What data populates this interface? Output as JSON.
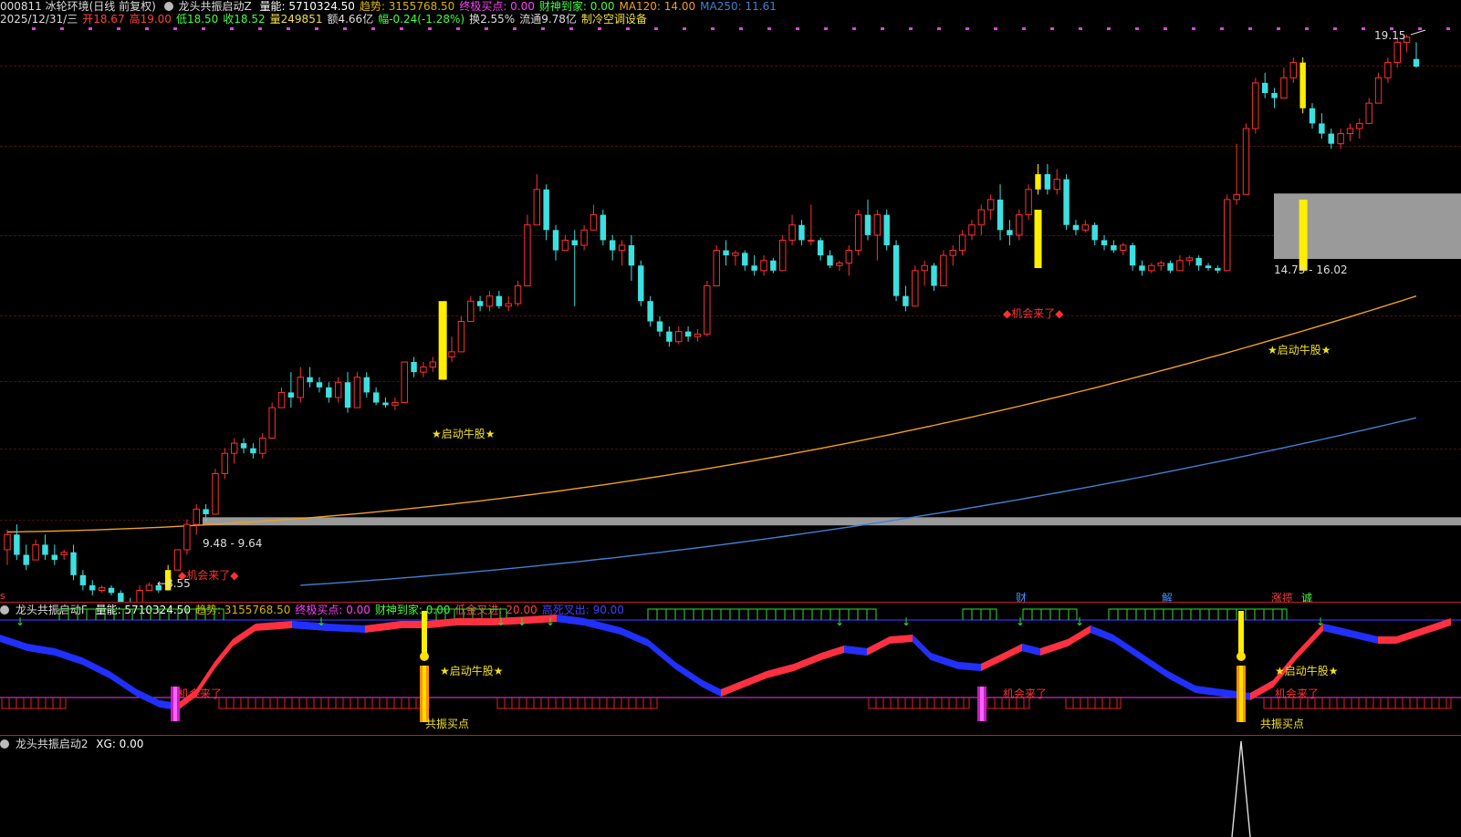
{
  "header": {
    "code_name": "000811 冰轮环境(日线 前复权)",
    "indicator_name": "龙头共振启动Z",
    "fields": [
      {
        "text": "量能: 5710324.50",
        "color": "#ffffff"
      },
      {
        "text": "趋势: 3155768.50",
        "color": "#d8b400"
      },
      {
        "text": "终极买点: 0.00",
        "color": "#ff40ff"
      },
      {
        "text": "财神到家: 0.00",
        "color": "#40ff40"
      },
      {
        "text": "MA120: 14.00",
        "color": "#f0a020"
      },
      {
        "text": "MA250: 11.61",
        "color": "#4080d0"
      }
    ],
    "quote": [
      {
        "text": "2025/12/31/三",
        "color": "#dddddd"
      },
      {
        "text": "开18.67",
        "color": "#ff4040"
      },
      {
        "text": "高19.00",
        "color": "#ff4040"
      },
      {
        "text": "低18.50",
        "color": "#40ff40"
      },
      {
        "text": "收18.52",
        "color": "#40ff40"
      },
      {
        "text": "量249851",
        "color": "#f0e040"
      },
      {
        "text": "额4.66亿",
        "color": "#dddddd"
      },
      {
        "text": "幅-0.24(-1.28%)",
        "color": "#40ff40"
      },
      {
        "text": "换2.55%",
        "color": "#dddddd"
      },
      {
        "text": "流通9.78亿",
        "color": "#dddddd"
      },
      {
        "text": "制冷空调设备",
        "color": "#f0e040"
      }
    ]
  },
  "main_chart": {
    "labels": {
      "high_price": "19.15",
      "low_price": "8.55",
      "zone_low": "9.48 - 9.64",
      "zone_high": "14.73 - 16.02",
      "signal_start": "★启动牛股★",
      "signal_chance": "◆机会来了◆"
    },
    "bottom_tags": [
      {
        "text": "财",
        "color": "#4090ff"
      },
      {
        "text": "解",
        "color": "#4090ff"
      },
      {
        "text": "涨揽",
        "color": "#ff4040"
      },
      {
        "text": "诚",
        "color": "#40ff40"
      }
    ]
  },
  "sub_chart_1": {
    "name": "龙头共振启动F",
    "fields": [
      {
        "text": "量能: 5710324.50",
        "color": "#ffffff"
      },
      {
        "text": "趋势: 3155768.50",
        "color": "#d8b400"
      },
      {
        "text": "终极买点: 0.00",
        "color": "#ff40ff"
      },
      {
        "text": "财神到家: 0.00",
        "color": "#40ff40"
      },
      {
        "text": "低金叉进: 20.00",
        "color": "#ff4040"
      },
      {
        "text": "高死叉出: 90.00",
        "color": "#4040ff"
      }
    ],
    "labels": {
      "start": "★启动牛股★",
      "chance": "机会来了",
      "buy": "共振买点"
    }
  },
  "sub_chart_2": {
    "name": "龙头共振启动2",
    "fields": [
      {
        "text": "XG: 0.00",
        "color": "#ffffff"
      }
    ]
  },
  "chart_data": {
    "type": "candlestick",
    "ma_series": [
      {
        "name": "MA120",
        "color": "#f0a020",
        "last_value": 14.0
      },
      {
        "name": "MA250",
        "color": "#4080d0",
        "last_value": 11.61
      }
    ],
    "candles": [
      [
        9.0,
        9.4,
        8.7,
        9.3
      ],
      [
        9.3,
        9.5,
        8.8,
        8.9
      ],
      [
        8.9,
        9.1,
        8.6,
        8.7
      ],
      [
        8.8,
        9.2,
        8.8,
        9.1
      ],
      [
        9.1,
        9.3,
        8.8,
        8.9
      ],
      [
        8.9,
        9.1,
        8.7,
        8.8
      ],
      [
        8.9,
        9.0,
        8.8,
        8.95
      ],
      [
        8.95,
        9.1,
        8.4,
        8.5
      ],
      [
        8.5,
        8.6,
        8.2,
        8.3
      ],
      [
        8.3,
        8.4,
        8.1,
        8.2
      ],
      [
        8.2,
        8.3,
        8.15,
        8.25
      ],
      [
        8.25,
        8.3,
        8.1,
        8.15
      ],
      [
        8.15,
        8.2,
        7.9,
        7.95
      ],
      [
        7.95,
        8.05,
        7.85,
        7.9
      ],
      [
        7.9,
        8.3,
        7.9,
        8.2
      ],
      [
        8.2,
        8.35,
        8.2,
        8.3
      ],
      [
        8.3,
        8.35,
        8.15,
        8.2
      ],
      [
        8.2,
        8.7,
        8.2,
        8.6
      ],
      [
        8.6,
        9.0,
        8.6,
        9.0
      ],
      [
        9.0,
        9.6,
        8.9,
        9.5
      ],
      [
        9.5,
        9.9,
        9.3,
        9.8
      ],
      [
        9.8,
        9.9,
        9.55,
        9.7
      ],
      [
        9.7,
        10.6,
        9.7,
        10.5
      ],
      [
        10.5,
        11.0,
        10.4,
        10.9
      ],
      [
        10.9,
        11.2,
        10.7,
        11.1
      ],
      [
        11.1,
        11.2,
        10.9,
        11.0
      ],
      [
        11.0,
        11.1,
        10.8,
        10.9
      ],
      [
        10.9,
        11.3,
        10.8,
        11.2
      ],
      [
        11.2,
        11.9,
        11.2,
        11.8
      ],
      [
        11.8,
        12.2,
        11.8,
        12.1
      ],
      [
        12.1,
        12.5,
        11.8,
        12.0
      ],
      [
        12.0,
        12.6,
        11.9,
        12.4
      ],
      [
        12.4,
        12.6,
        12.2,
        12.3
      ],
      [
        12.3,
        12.4,
        12.1,
        12.2
      ],
      [
        12.2,
        12.3,
        11.9,
        12.0
      ],
      [
        12.0,
        12.4,
        11.9,
        12.3
      ],
      [
        12.3,
        12.5,
        11.7,
        11.8
      ],
      [
        11.8,
        12.5,
        11.8,
        12.4
      ],
      [
        12.4,
        12.5,
        12.0,
        12.1
      ],
      [
        12.1,
        12.2,
        11.85,
        11.9
      ],
      [
        11.9,
        12.0,
        11.8,
        11.85
      ],
      [
        11.85,
        12.0,
        11.75,
        11.9
      ],
      [
        11.9,
        12.6,
        11.9,
        12.7
      ],
      [
        12.7,
        12.8,
        12.4,
        12.5
      ],
      [
        12.5,
        12.7,
        12.4,
        12.6
      ],
      [
        12.6,
        12.8,
        12.5,
        12.7
      ],
      [
        12.7,
        12.9,
        12.6,
        12.8
      ],
      [
        12.8,
        13.2,
        12.7,
        12.9
      ],
      [
        12.9,
        13.6,
        12.9,
        13.5
      ],
      [
        13.5,
        14.0,
        13.5,
        13.9
      ],
      [
        13.9,
        14.0,
        13.7,
        13.8
      ],
      [
        13.8,
        14.1,
        13.7,
        14.0
      ],
      [
        14.0,
        14.1,
        13.75,
        13.8
      ],
      [
        13.8,
        14.0,
        13.7,
        13.85
      ],
      [
        13.85,
        14.3,
        13.8,
        14.2
      ],
      [
        14.2,
        15.6,
        14.2,
        15.4
      ],
      [
        15.4,
        16.4,
        15.4,
        16.1
      ],
      [
        16.1,
        16.2,
        15.1,
        15.3
      ],
      [
        15.3,
        15.4,
        14.7,
        14.9
      ],
      [
        14.9,
        15.2,
        14.9,
        15.1
      ],
      [
        15.1,
        15.3,
        13.8,
        15.0
      ],
      [
        15.0,
        15.4,
        14.9,
        15.3
      ],
      [
        15.3,
        15.8,
        15.3,
        15.6
      ],
      [
        15.6,
        15.7,
        15.0,
        15.1
      ],
      [
        15.1,
        15.2,
        14.7,
        14.9
      ],
      [
        14.9,
        15.1,
        14.6,
        15.0
      ],
      [
        15.0,
        15.2,
        14.3,
        14.6
      ],
      [
        14.6,
        14.7,
        13.8,
        13.9
      ],
      [
        13.9,
        14.0,
        13.4,
        13.5
      ],
      [
        13.5,
        13.6,
        13.2,
        13.3
      ],
      [
        13.3,
        13.4,
        13.0,
        13.1
      ],
      [
        13.1,
        13.4,
        13.05,
        13.3
      ],
      [
        13.3,
        13.4,
        13.1,
        13.2
      ],
      [
        13.2,
        13.35,
        13.1,
        13.25
      ],
      [
        13.25,
        14.3,
        13.2,
        14.2
      ],
      [
        14.2,
        15.0,
        14.2,
        14.9
      ],
      [
        14.9,
        15.1,
        14.6,
        14.8
      ],
      [
        14.8,
        14.9,
        14.6,
        14.85
      ],
      [
        14.85,
        14.9,
        14.5,
        14.6
      ],
      [
        14.6,
        14.8,
        14.4,
        14.5
      ],
      [
        14.5,
        14.8,
        14.4,
        14.7
      ],
      [
        14.7,
        14.75,
        14.45,
        14.5
      ],
      [
        14.5,
        15.2,
        14.5,
        15.1
      ],
      [
        15.1,
        15.6,
        15.0,
        15.4
      ],
      [
        15.4,
        15.5,
        15.0,
        15.1
      ],
      [
        15.1,
        15.8,
        15.0,
        15.1
      ],
      [
        15.1,
        15.15,
        14.7,
        14.8
      ],
      [
        14.8,
        14.9,
        14.55,
        14.6
      ],
      [
        14.6,
        14.7,
        14.5,
        14.65
      ],
      [
        14.65,
        15.0,
        14.4,
        14.9
      ],
      [
        14.9,
        15.7,
        14.8,
        15.6
      ],
      [
        15.6,
        15.9,
        15.1,
        15.2
      ],
      [
        15.2,
        15.7,
        14.7,
        15.6
      ],
      [
        15.6,
        15.7,
        14.9,
        15.0
      ],
      [
        15.0,
        15.1,
        13.9,
        14.0
      ],
      [
        14.0,
        14.2,
        13.7,
        13.8
      ],
      [
        13.8,
        14.6,
        13.8,
        14.5
      ],
      [
        14.5,
        14.7,
        14.2,
        14.6
      ],
      [
        14.6,
        14.65,
        14.1,
        14.2
      ],
      [
        14.2,
        14.9,
        14.2,
        14.8
      ],
      [
        14.8,
        15.0,
        14.6,
        14.9
      ],
      [
        14.9,
        15.3,
        14.8,
        15.2
      ],
      [
        15.2,
        15.5,
        15.1,
        15.4
      ],
      [
        15.4,
        15.8,
        15.2,
        15.7
      ],
      [
        15.7,
        16.0,
        15.5,
        15.9
      ],
      [
        15.9,
        16.2,
        15.1,
        15.3
      ],
      [
        15.3,
        15.5,
        15.0,
        15.2
      ],
      [
        15.2,
        15.7,
        15.1,
        15.6
      ],
      [
        15.6,
        16.2,
        15.5,
        16.1
      ],
      [
        16.1,
        16.6,
        16.0,
        16.4
      ],
      [
        16.4,
        16.6,
        16.0,
        16.1
      ],
      [
        16.1,
        16.5,
        16.0,
        16.3
      ],
      [
        16.3,
        16.4,
        15.3,
        15.4
      ],
      [
        15.4,
        15.5,
        15.2,
        15.3
      ],
      [
        15.3,
        15.5,
        15.25,
        15.4
      ],
      [
        15.4,
        15.45,
        15.0,
        15.1
      ],
      [
        15.1,
        15.2,
        14.9,
        15.0
      ],
      [
        15.0,
        15.1,
        14.85,
        14.9
      ],
      [
        14.9,
        15.05,
        14.8,
        15.0
      ],
      [
        15.0,
        15.05,
        14.5,
        14.6
      ],
      [
        14.6,
        14.7,
        14.4,
        14.5
      ],
      [
        14.5,
        14.65,
        14.45,
        14.6
      ],
      [
        14.6,
        14.7,
        14.5,
        14.65
      ],
      [
        14.65,
        14.7,
        14.45,
        14.5
      ],
      [
        14.5,
        14.8,
        14.5,
        14.7
      ],
      [
        14.7,
        14.8,
        14.6,
        14.75
      ],
      [
        14.75,
        14.8,
        14.5,
        14.6
      ],
      [
        14.6,
        14.65,
        14.5,
        14.55
      ],
      [
        14.55,
        14.6,
        14.45,
        14.5
      ],
      [
        14.5,
        16.0,
        14.5,
        15.9
      ],
      [
        15.9,
        17.0,
        15.8,
        16.0
      ],
      [
        16.0,
        17.4,
        16.0,
        17.3
      ],
      [
        17.3,
        18.3,
        17.2,
        18.2
      ],
      [
        18.2,
        18.4,
        17.9,
        18.0
      ],
      [
        18.0,
        18.1,
        17.7,
        17.9
      ],
      [
        17.9,
        18.5,
        17.9,
        18.3
      ],
      [
        18.3,
        18.7,
        18.2,
        18.6
      ],
      [
        18.6,
        18.7,
        17.6,
        17.7
      ],
      [
        17.7,
        17.8,
        17.3,
        17.4
      ],
      [
        17.4,
        17.6,
        17.1,
        17.2
      ],
      [
        17.2,
        17.3,
        16.9,
        17.0
      ],
      [
        17.0,
        17.3,
        16.9,
        17.2
      ],
      [
        17.2,
        17.4,
        17.05,
        17.3
      ],
      [
        17.3,
        17.5,
        17.1,
        17.4
      ],
      [
        17.4,
        17.9,
        17.4,
        17.8
      ],
      [
        17.8,
        18.4,
        17.8,
        18.3
      ],
      [
        18.3,
        18.7,
        18.2,
        18.6
      ],
      [
        18.6,
        19.1,
        18.5,
        19.0
      ],
      [
        19.0,
        19.15,
        18.8,
        19.1
      ],
      [
        18.67,
        19.0,
        18.5,
        18.52
      ]
    ]
  }
}
